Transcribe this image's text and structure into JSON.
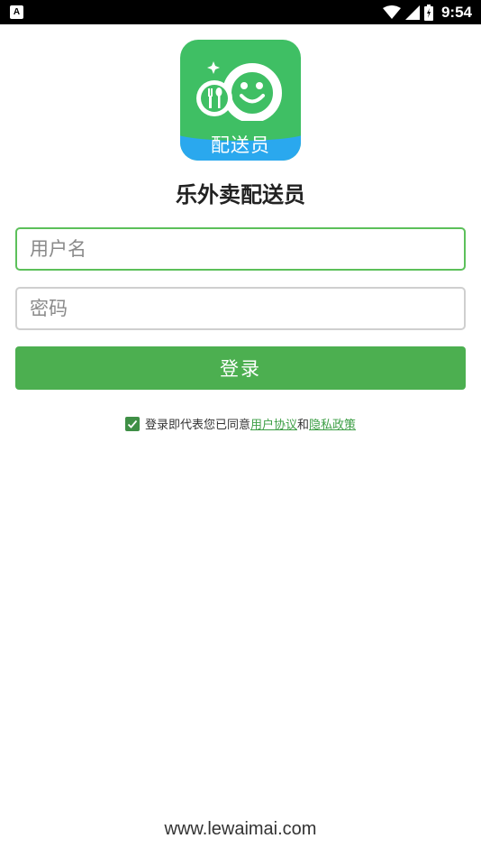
{
  "status_bar": {
    "left_icon_label": "A",
    "time": "9:54",
    "icons": [
      "wifi-icon",
      "signal-icon",
      "battery-icon"
    ]
  },
  "logo": {
    "text": "配送员",
    "colors": {
      "green": "#3fbf64",
      "blue": "#2aa8ee"
    }
  },
  "app_title": "乐外卖配送员",
  "form": {
    "username_placeholder": "用户名",
    "username_value": "",
    "password_placeholder": "密码",
    "password_value": "",
    "login_label": "登录"
  },
  "agreement": {
    "checked": true,
    "prefix": "登录即代表您已同意",
    "user_agreement": "用户协议",
    "conjunction": "和",
    "privacy_policy": "隐私政策"
  },
  "footer": {
    "website": "www.lewaimai.com"
  },
  "colors": {
    "accent": "#4caf50",
    "focus_border": "#5cc05a",
    "link": "#3d9e45"
  }
}
